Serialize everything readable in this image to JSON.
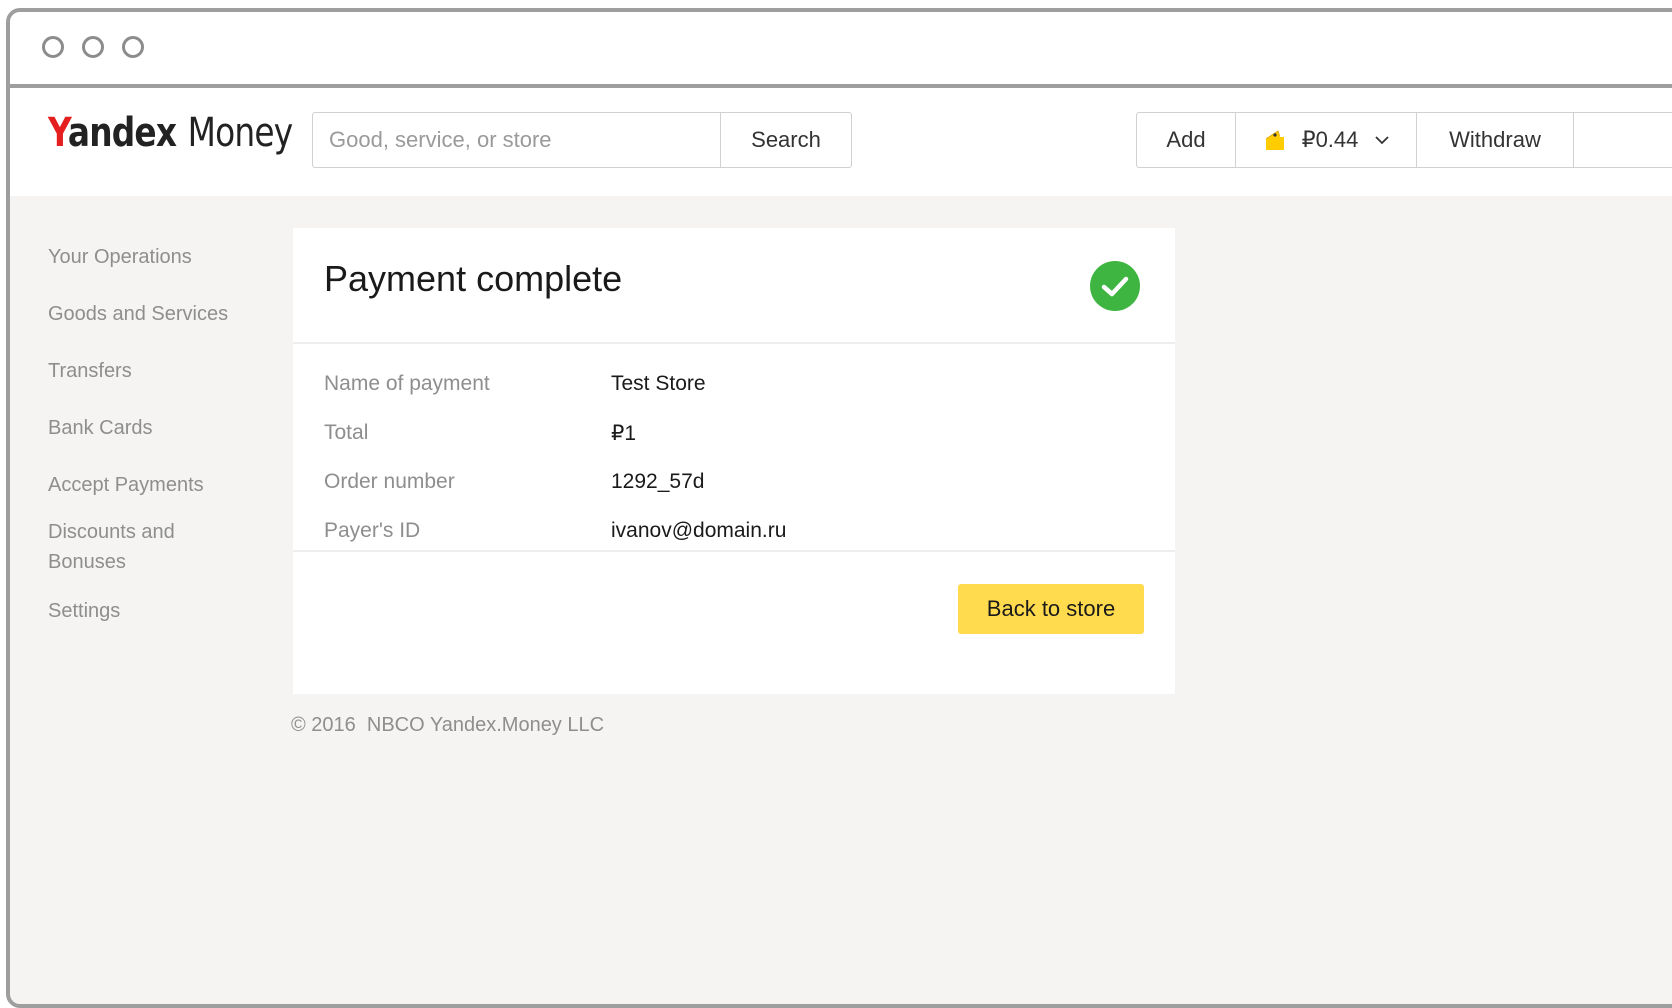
{
  "window": {
    "controls": [
      "window-dot",
      "window-dot",
      "window-dot"
    ]
  },
  "header": {
    "logo": {
      "y": "Y",
      "andex": "andex",
      "money": "Money"
    },
    "search": {
      "placeholder": "Good, service, or store",
      "value": "",
      "button_label": "Search"
    },
    "wallet": {
      "add_label": "Add",
      "balance": "₽0.44",
      "withdraw_label": "Withdraw",
      "icon": "wallet-icon",
      "accent": "#ffcc00"
    }
  },
  "sidebar": {
    "items": [
      {
        "label": "Your Operations"
      },
      {
        "label": "Goods and Services"
      },
      {
        "label": "Transfers"
      },
      {
        "label": "Bank Cards"
      },
      {
        "label": "Accept Payments"
      },
      {
        "label": "Discounts and Bonuses"
      },
      {
        "label": "Settings"
      }
    ]
  },
  "payment": {
    "title": "Payment complete",
    "status_icon": "check-circle-icon",
    "status_color": "#3fb541",
    "details": [
      {
        "label": "Name of payment",
        "value": "Test Store"
      },
      {
        "label": "Total",
        "value": "₽1"
      },
      {
        "label": "Order number",
        "value": "1292_57d"
      },
      {
        "label": "Payer's ID",
        "value": "ivanov@domain.ru"
      }
    ],
    "back_button": "Back to store",
    "button_color": "#ffdb4d"
  },
  "footer": {
    "copyright": "© 2016  NBCO Yandex.Money LLC"
  }
}
